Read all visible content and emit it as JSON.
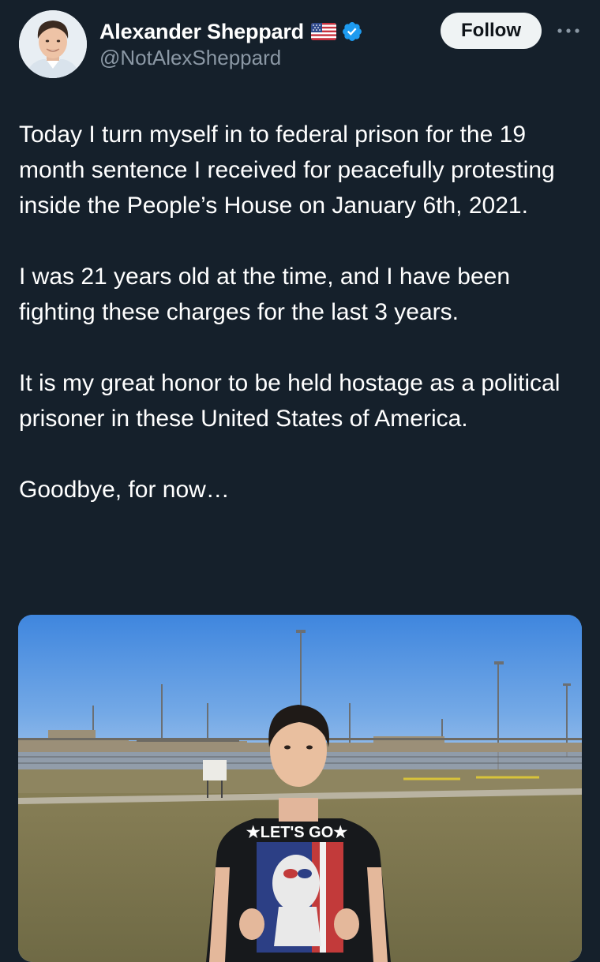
{
  "author": {
    "display_name": "Alexander Sheppard",
    "handle": "@NotAlexSheppard",
    "flag_icon": "us-flag-icon",
    "verified_icon": "verified-badge-icon",
    "verified_color": "#1d9bf0"
  },
  "actions": {
    "follow_label": "Follow",
    "more_icon": "more-horizontal-icon"
  },
  "tweet": {
    "paragraphs": [
      "Today I turn myself in to federal prison for the 19 month sentence I received for peacefully protesting inside the People’s House on January 6th, 2021.",
      "I was 21 years old at the time, and I have been fighting these charges for the last 3 years.",
      "It is my great honor to be held hostage as a political prisoner in these United States of America.",
      "Goodbye, for now…"
    ]
  },
  "media": {
    "shirt_text": "★LET'S GO★"
  },
  "colors": {
    "background": "#15202b",
    "text": "#ffffff",
    "secondary_text": "#8b98a5",
    "follow_bg": "#eff3f4"
  }
}
